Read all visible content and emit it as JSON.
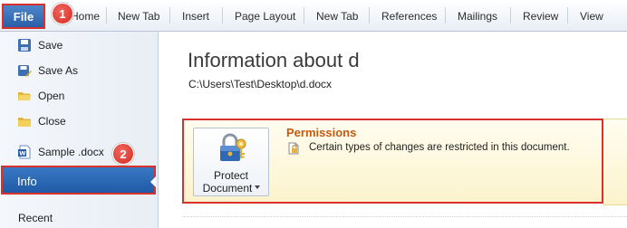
{
  "ribbon": {
    "file_label": "File",
    "tabs": [
      {
        "label": "Home",
        "name": "tab-home"
      },
      {
        "label": "New Tab",
        "name": "tab-new-tab-1"
      },
      {
        "label": "Insert",
        "name": "tab-insert"
      },
      {
        "label": "Page Layout",
        "name": "tab-page-layout"
      },
      {
        "label": "New Tab",
        "name": "tab-new-tab-2"
      },
      {
        "label": "References",
        "name": "tab-references"
      },
      {
        "label": "Mailings",
        "name": "tab-mailings"
      },
      {
        "label": "Review",
        "name": "tab-review"
      },
      {
        "label": "View",
        "name": "tab-view"
      }
    ]
  },
  "backstage": {
    "items": [
      {
        "label": "Save",
        "icon": "save-icon"
      },
      {
        "label": "Save As",
        "icon": "save-as-icon"
      },
      {
        "label": "Open",
        "icon": "open-folder-icon"
      },
      {
        "label": "Close",
        "icon": "close-folder-icon"
      },
      {
        "label": "Sample .docx",
        "icon": "word-document-icon"
      }
    ],
    "info_label": "Info",
    "recent_label": "Recent"
  },
  "badges": {
    "step1": "1",
    "step2": "2"
  },
  "info": {
    "title": "Information about d",
    "path": "C:\\Users\\Test\\Desktop\\d.docx",
    "protect_button": {
      "line1": "Protect",
      "line2": "Document"
    },
    "permissions_title": "Permissions",
    "permissions_text": "Certain types of changes are restricted in this document."
  },
  "colors": {
    "highlight_border": "#d9312b",
    "file_tab": "#2a5fa8",
    "permissions_title": "#c55a11",
    "panel_bg": "#fcf3cc"
  }
}
